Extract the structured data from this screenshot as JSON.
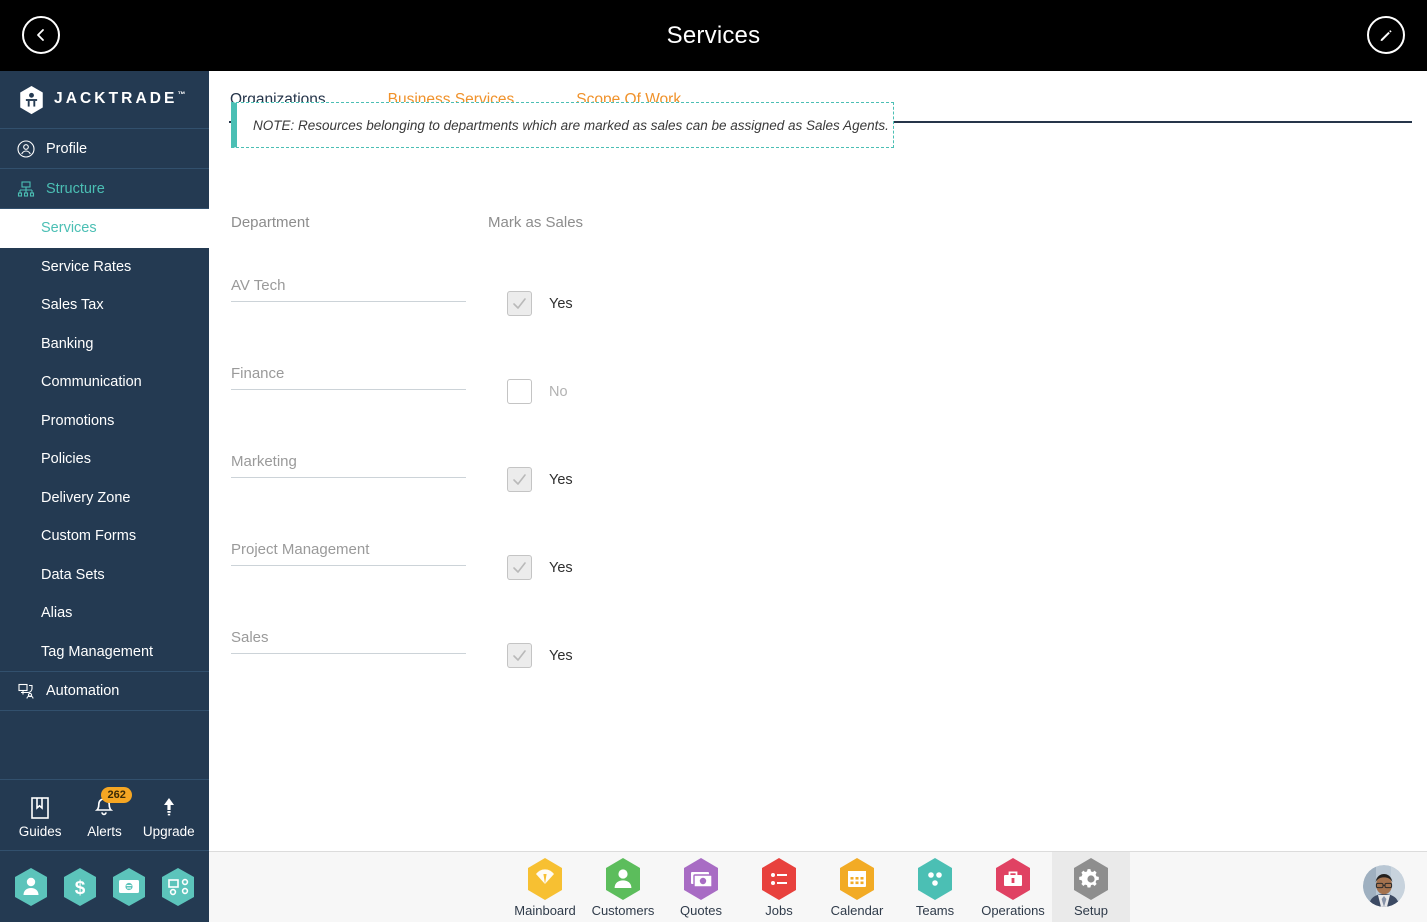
{
  "header": {
    "title": "Services",
    "back_icon": "chevron-left-icon",
    "edit_icon": "pencil-icon"
  },
  "sidebar": {
    "brand": {
      "name": "JACKTRADE",
      "tm": "™",
      "logo_icon": "jacktrade-hex-logo"
    },
    "top_items": [
      {
        "label": "Profile",
        "icon": "user-circle-icon",
        "accent": false
      },
      {
        "label": "Structure",
        "icon": "sitemap-icon",
        "accent": true
      }
    ],
    "sub_items": [
      {
        "label": "Services",
        "active": true
      },
      {
        "label": "Service Rates",
        "active": false
      },
      {
        "label": "Sales Tax",
        "active": false
      },
      {
        "label": "Banking",
        "active": false
      },
      {
        "label": "Communication",
        "active": false
      },
      {
        "label": "Promotions",
        "active": false
      },
      {
        "label": "Policies",
        "active": false
      },
      {
        "label": "Delivery Zone",
        "active": false
      },
      {
        "label": "Custom Forms",
        "active": false
      },
      {
        "label": "Data Sets",
        "active": false
      },
      {
        "label": "Alias",
        "active": false
      },
      {
        "label": "Tag Management",
        "active": false
      }
    ],
    "automation": {
      "label": "Automation",
      "icon": "automation-icon",
      "accent": false
    },
    "tools": [
      {
        "label": "Guides",
        "icon": "book-icon",
        "badge": null
      },
      {
        "label": "Alerts",
        "icon": "bell-icon",
        "badge": "262"
      },
      {
        "label": "Upgrade",
        "icon": "arrow-up-icon",
        "badge": null
      }
    ],
    "hex_shortcuts": [
      {
        "icon": "person-hex-icon"
      },
      {
        "icon": "dollar-hex-icon"
      },
      {
        "icon": "payment-hex-icon"
      },
      {
        "icon": "workflow-hex-icon"
      }
    ],
    "colors": {
      "bg": "#243a52",
      "accent": "#4bbfb4",
      "badge": "#f5a623"
    }
  },
  "main": {
    "tabs": [
      {
        "label": "Organizations",
        "active": true
      },
      {
        "label": "Business Services",
        "active": false
      },
      {
        "label": "Scope Of Work",
        "active": false
      }
    ],
    "note": "NOTE: Resources belonging to departments which are marked as sales can be assigned as Sales Agents.",
    "table": {
      "headers": {
        "department": "Department",
        "mark_as_sales": "Mark as Sales"
      },
      "rows": [
        {
          "department": "AV Tech",
          "checked": true,
          "mark_label": "Yes"
        },
        {
          "department": "Finance",
          "checked": false,
          "mark_label": "No"
        },
        {
          "department": "Marketing",
          "checked": true,
          "mark_label": "Yes"
        },
        {
          "department": "Project Management",
          "checked": true,
          "mark_label": "Yes"
        },
        {
          "department": "Sales",
          "checked": true,
          "mark_label": "Yes"
        }
      ]
    },
    "colors": {
      "tab_active": "#26354a",
      "tab_inactive": "#f0922b",
      "note_accent": "#4bbfb4"
    }
  },
  "bottom_nav": {
    "items": [
      {
        "label": "Mainboard",
        "icon": "mainboard-hex-icon",
        "color": "#f7c032",
        "active": false
      },
      {
        "label": "Customers",
        "icon": "customers-hex-icon",
        "color": "#5cbd5c",
        "active": false
      },
      {
        "label": "Quotes",
        "icon": "quotes-hex-icon",
        "color": "#a濃",
        "active": false
      },
      {
        "label": "Jobs",
        "icon": "jobs-hex-icon",
        "color": "#e8413d",
        "active": false
      },
      {
        "label": "Calendar",
        "icon": "calendar-hex-icon",
        "color": "#f2ab25",
        "active": false
      },
      {
        "label": "Teams",
        "icon": "teams-hex-icon",
        "color": "#4bbfb4",
        "active": false
      },
      {
        "label": "Operations",
        "icon": "operations-hex-icon",
        "color": "#e04263",
        "active": false
      },
      {
        "label": "Setup",
        "icon": "setup-hex-icon",
        "color": "#8e8e8e",
        "active": true
      }
    ],
    "avatar": {
      "icon": "user-avatar-photo"
    }
  }
}
